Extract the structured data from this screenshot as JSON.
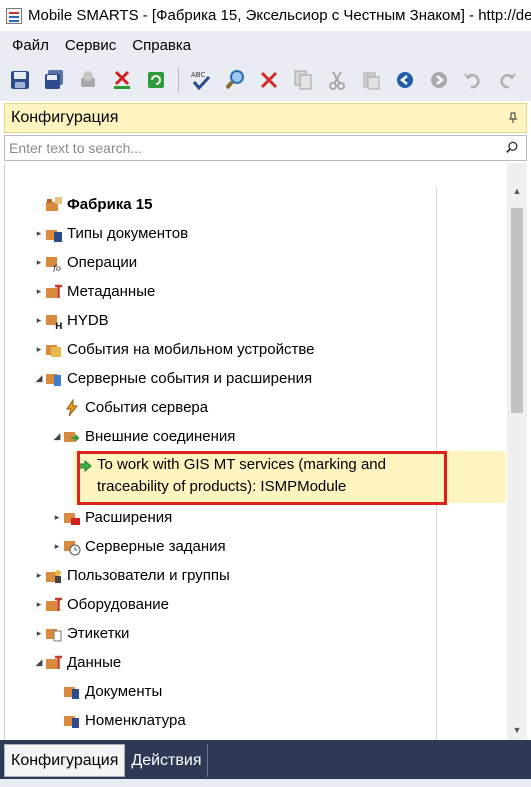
{
  "window": {
    "title": "Mobile SMARTS - [Фабрика 15, Эксельсиор с Честным Знаком] - http://de"
  },
  "menu": {
    "items": [
      {
        "label": "Файл"
      },
      {
        "label": "Сервис"
      },
      {
        "label": "Справка"
      }
    ]
  },
  "toolbar": {
    "buttons": [
      {
        "name": "save-icon"
      },
      {
        "name": "save-all-icon"
      },
      {
        "name": "publish-icon"
      },
      {
        "name": "delete-configuration-icon"
      },
      {
        "name": "refresh-icon"
      },
      {
        "name": "spell-check-icon"
      },
      {
        "name": "find-icon"
      },
      {
        "name": "delete-icon"
      },
      {
        "name": "copy-icon"
      },
      {
        "name": "cut-icon"
      },
      {
        "name": "paste-icon"
      },
      {
        "name": "back-icon"
      },
      {
        "name": "forward-icon"
      },
      {
        "name": "undo-icon"
      },
      {
        "name": "redo-icon"
      }
    ]
  },
  "panel": {
    "title": "Конфигурация",
    "search_placeholder": "Enter text to search..."
  },
  "tree": {
    "items": [
      {
        "label": "Фабрика 15",
        "level": 0,
        "expander": "",
        "icon": "factory-root-icon",
        "bold": true
      },
      {
        "label": "Типы документов",
        "level": 0,
        "expander": "▸",
        "icon": "document-types-icon"
      },
      {
        "label": "Операции",
        "level": 0,
        "expander": "▸",
        "icon": "operations-icon"
      },
      {
        "label": "Метаданные",
        "level": 0,
        "expander": "▸",
        "icon": "metadata-icon"
      },
      {
        "label": "HYDB",
        "level": 0,
        "expander": "▸",
        "icon": "hydb-icon"
      },
      {
        "label": "События на мобильном устройстве",
        "level": 0,
        "expander": "▸",
        "icon": "mobile-events-icon"
      },
      {
        "label": "Серверные события и расширения",
        "level": 0,
        "expander": "◢",
        "icon": "server-events-icon"
      },
      {
        "label": "События сервера",
        "level": 1,
        "expander": "",
        "icon": "lightning-icon"
      },
      {
        "label": "Внешние соединения",
        "level": 1,
        "expander": "◢",
        "icon": "external-connections-icon"
      },
      {
        "label": "To work with GIS MT services (marking and traceability of products): ISMPModule",
        "level": 2,
        "expander": "",
        "icon": "green-arrow-icon",
        "selected": true
      },
      {
        "label": "Расширения",
        "level": 1,
        "expander": "▸",
        "icon": "extensions-icon"
      },
      {
        "label": "Серверные задания",
        "level": 1,
        "expander": "▸",
        "icon": "server-tasks-icon"
      },
      {
        "label": "Пользователи и группы",
        "level": 0,
        "expander": "▸",
        "icon": "users-groups-icon"
      },
      {
        "label": "Оборудование",
        "level": 0,
        "expander": "▸",
        "icon": "equipment-icon"
      },
      {
        "label": "Этикетки",
        "level": 0,
        "expander": "▸",
        "icon": "labels-icon"
      },
      {
        "label": "Данные",
        "level": 0,
        "expander": "◢",
        "icon": "data-icon"
      },
      {
        "label": "Документы",
        "level": 1,
        "expander": "",
        "icon": "documents-icon"
      },
      {
        "label": "Номенклатура",
        "level": 1,
        "expander": "",
        "icon": "nomenclature-icon"
      }
    ]
  },
  "bottom_tabs": [
    {
      "label": "Конфигурация",
      "active": true
    },
    {
      "label": "Действия",
      "active": false
    }
  ],
  "colors": {
    "selection_fill": "#fdf4bf",
    "highlight_border": "#e0201b",
    "tab_strip": "#2e3a55"
  }
}
